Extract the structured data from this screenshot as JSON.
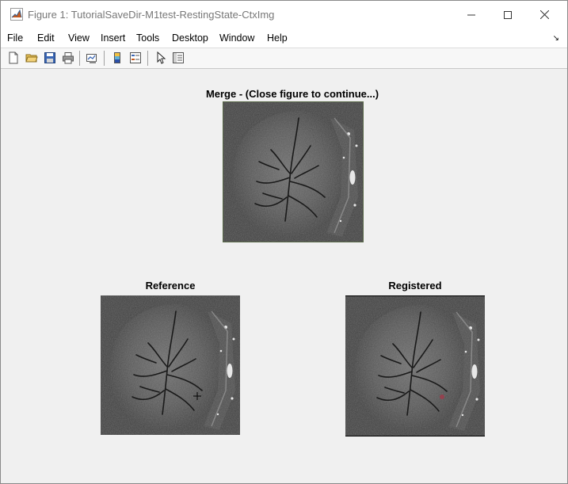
{
  "window": {
    "title": "Figure 1: TutorialSaveDir-M1test-RestingState-CtxImg",
    "app_icon": "matlab-icon",
    "controls": [
      "minimize-icon",
      "maximize-icon",
      "close-icon"
    ]
  },
  "menu": {
    "items": [
      {
        "label": "File"
      },
      {
        "label": "Edit"
      },
      {
        "label": "View"
      },
      {
        "label": "Insert"
      },
      {
        "label": "Tools"
      },
      {
        "label": "Desktop"
      },
      {
        "label": "Window"
      },
      {
        "label": "Help"
      }
    ]
  },
  "toolbar": {
    "icons": [
      "new-figure-icon",
      "open-file-icon",
      "save-icon",
      "print-icon",
      "link-plot-icon",
      "insert-colorbar-icon",
      "insert-legend-icon",
      "edit-plot-icon",
      "property-inspector-icon"
    ]
  },
  "axes": {
    "merge": {
      "title": "Merge - (Close figure to continue...)"
    },
    "reference": {
      "title": "Reference"
    },
    "registered": {
      "title": "Registered"
    }
  }
}
